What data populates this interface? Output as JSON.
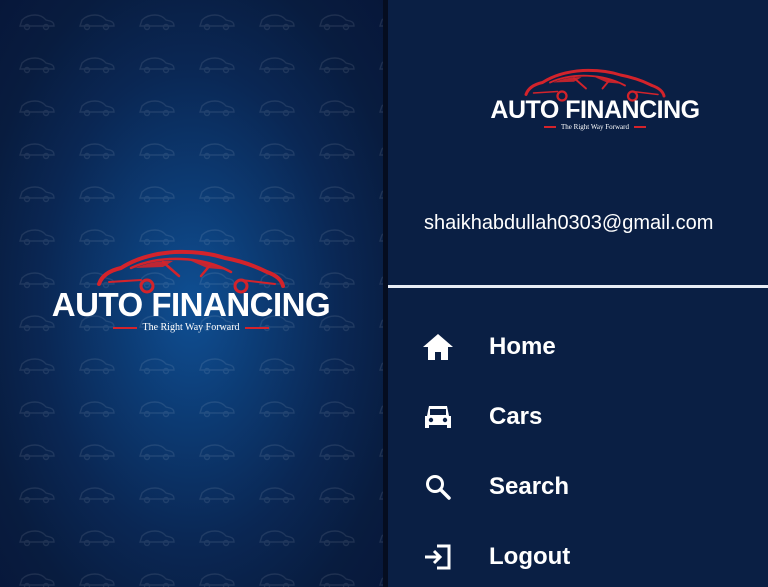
{
  "splash": {
    "brand": "AUTO FINANCING",
    "tagline": "The Right Way Forward"
  },
  "drawer": {
    "brand": "AUTO FINANCING",
    "tagline": "The Right Way Forward",
    "email": "shaikhabdullah0303@gmail.com",
    "menu": [
      {
        "label": "Home",
        "icon": "home-icon"
      },
      {
        "label": "Cars",
        "icon": "car-icon"
      },
      {
        "label": "Search",
        "icon": "search-icon"
      },
      {
        "label": "Logout",
        "icon": "logout-icon"
      }
    ]
  },
  "colors": {
    "accent_red": "#d3232b",
    "drawer_bg": "#0a1f44",
    "text": "#ffffff"
  }
}
